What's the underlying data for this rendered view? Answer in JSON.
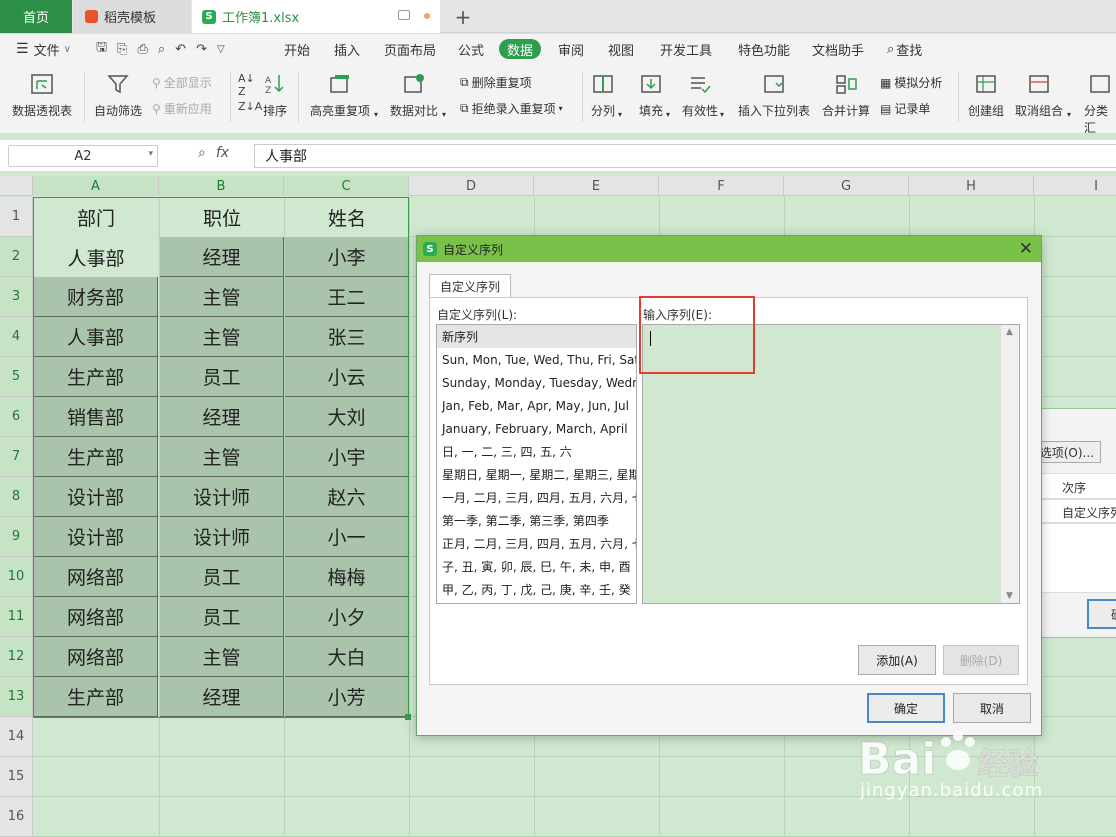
{
  "tabs": {
    "home": "首页",
    "template": "稻壳模板",
    "workbook": "工作簿1.xlsx",
    "plus": "+"
  },
  "menu": {
    "file": "文件",
    "items": [
      "开始",
      "插入",
      "页面布局",
      "公式",
      "数据",
      "审阅",
      "视图",
      "开发工具",
      "特色功能",
      "文档助手"
    ],
    "search": "查找"
  },
  "toolbar": {
    "pivot": "数据透视表",
    "autofilter": "自动筛选",
    "showall": "全部显示",
    "reapply": "重新应用",
    "sort": "排序",
    "highlight_dup": "高亮重复项",
    "compare": "数据对比",
    "remove_dup": "删除重复项",
    "reject_dup": "拒绝录入重复项",
    "split": "分列",
    "fill": "填充",
    "validity": "有效性",
    "dropdown": "插入下拉列表",
    "consolidate": "合并计算",
    "simulate": "模拟分析",
    "record": "记录单",
    "group": "创建组",
    "ungroup": "取消组合",
    "subtotal": "分类汇"
  },
  "formula": {
    "cell_ref": "A2",
    "fx": "fx",
    "value": "人事部"
  },
  "columns": [
    "A",
    "B",
    "C",
    "D",
    "E",
    "F",
    "G",
    "H",
    "I"
  ],
  "rows": [
    "1",
    "2",
    "3",
    "4",
    "5",
    "6",
    "7",
    "8",
    "9",
    "10",
    "11",
    "12",
    "13",
    "14",
    "15",
    "16"
  ],
  "sheet": {
    "header": [
      "部门",
      "职位",
      "姓名"
    ],
    "data": [
      [
        "人事部",
        "经理",
        "小李"
      ],
      [
        "财务部",
        "主管",
        "王二"
      ],
      [
        "人事部",
        "主管",
        "张三"
      ],
      [
        "生产部",
        "员工",
        "小云"
      ],
      [
        "销售部",
        "经理",
        "大刘"
      ],
      [
        "生产部",
        "主管",
        "小宇"
      ],
      [
        "设计部",
        "设计师",
        "赵六"
      ],
      [
        "设计部",
        "设计师",
        "小一"
      ],
      [
        "网络部",
        "员工",
        "梅梅"
      ],
      [
        "网络部",
        "员工",
        "小夕"
      ],
      [
        "网络部",
        "主管",
        "大白"
      ],
      [
        "生产部",
        "经理",
        "小芳"
      ]
    ]
  },
  "bg_dialog": {
    "options": "选项(O)...",
    "col_order": "次序",
    "cell_value": "自定义序列",
    "btn": "确"
  },
  "dialog": {
    "title": "自定义序列",
    "tab": "自定义序列",
    "list_label": "自定义序列(L):",
    "input_label": "输入序列(E):",
    "list": [
      "新序列",
      "Sun, Mon, Tue, Wed, Thu, Fri, Sat",
      "Sunday, Monday, Tuesday, Wednesday",
      "Jan, Feb, Mar, Apr, May, Jun, Jul",
      "January, February, March, April",
      "日, 一, 二, 三, 四, 五, 六",
      "星期日, 星期一, 星期二, 星期三, 星期四",
      "一月, 二月, 三月, 四月, 五月, 六月, 七月",
      "第一季, 第二季, 第三季, 第四季",
      "正月, 二月, 三月, 四月, 五月, 六月, 七月",
      "子, 丑, 寅, 卯, 辰, 巳, 午, 未, 申, 酉",
      "甲, 乙, 丙, 丁, 戊, 己, 庚, 辛, 壬, 癸"
    ],
    "add": "添加(A)",
    "delete": "删除(D)",
    "ok": "确定",
    "cancel": "取消"
  },
  "watermark": {
    "brand": "Baidu经验",
    "url": "jingyan.baidu.com"
  },
  "colors": {
    "accent": "#2d9e4f",
    "highlight": "#e03c31",
    "title_bar": "#7ac14a"
  }
}
